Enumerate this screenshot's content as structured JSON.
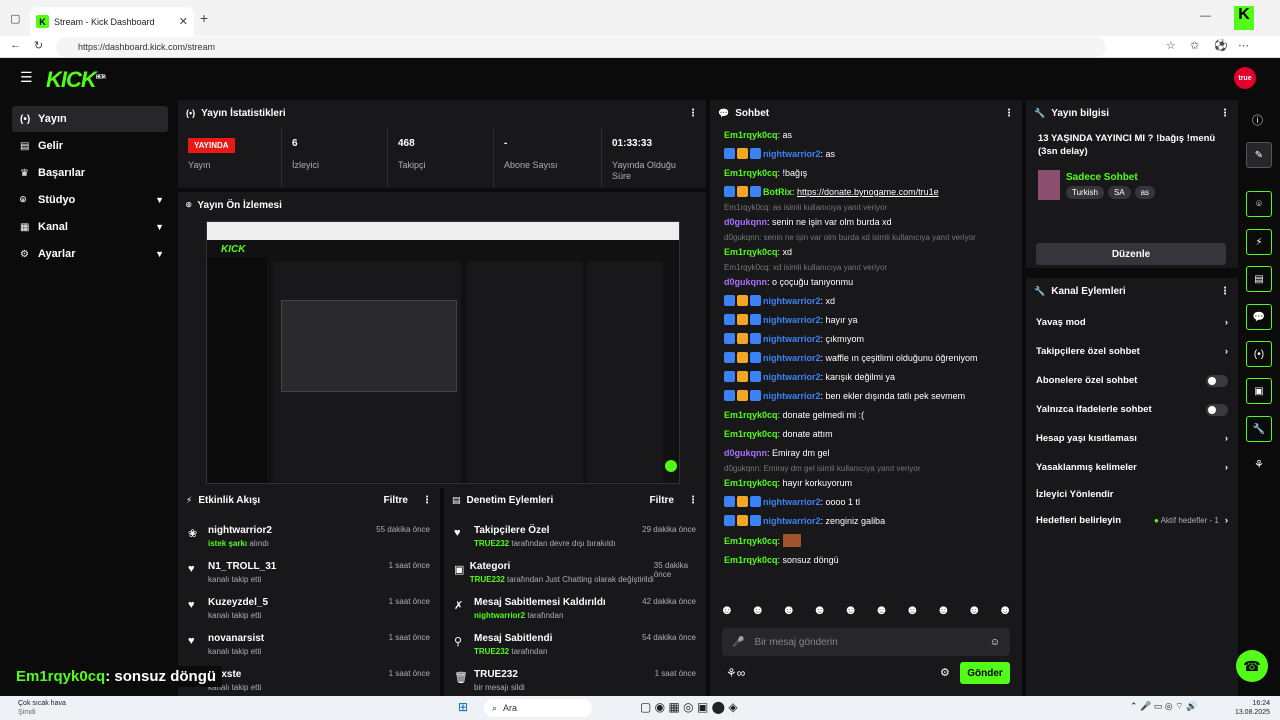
{
  "browser": {
    "tab_title": "Stream - Kick Dashboard",
    "url": "https://dashboard.kick.com/stream"
  },
  "app": {
    "logo": "KICK",
    "logo_badge": "BETA",
    "avatar_text": "true"
  },
  "sidebar": {
    "items": [
      {
        "label": "Yayın",
        "icon": "broadcast-icon"
      },
      {
        "label": "Gelir",
        "icon": "wallet-icon"
      },
      {
        "label": "Başarılar",
        "icon": "trophy-icon"
      },
      {
        "label": "Stüdyo",
        "icon": "studio-icon"
      },
      {
        "label": "Kanal",
        "icon": "channel-icon"
      },
      {
        "label": "Ayarlar",
        "icon": "gear-icon"
      }
    ]
  },
  "stats": {
    "title": "Yayın İstatistikleri",
    "live_badge": "YAYINDA",
    "items": [
      {
        "value": "",
        "label": "Yayın"
      },
      {
        "value": "6",
        "label": "İzleyici"
      },
      {
        "value": "468",
        "label": "Takipçi"
      },
      {
        "value": "-",
        "label": "Abone Sayısı"
      },
      {
        "value": "01:33:33",
        "label": "Yayında Olduğu Süre"
      }
    ]
  },
  "preview": {
    "title": "Yayın Ön İzlemesi"
  },
  "activity": {
    "title": "Etkinlik Akışı",
    "filter": "Filtre",
    "items": [
      {
        "user": "nightwarrior2",
        "sub_green": "istek şarkı",
        "sub": "alındı",
        "time": "55 dakika önce"
      },
      {
        "user": "N1_TROLL_31",
        "sub_green": "",
        "sub": "kanalı takip etti",
        "time": "1 saat önce"
      },
      {
        "user": "Kuzeyzdel_5",
        "sub_green": "",
        "sub": "kanalı takip etti",
        "time": "1 saat önce"
      },
      {
        "user": "novanarsist",
        "sub_green": "",
        "sub": "kanalı takip etti",
        "time": "1 saat önce"
      },
      {
        "user": "Doxste",
        "sub_green": "",
        "sub": "kanalı takip etti",
        "time": "1 saat önce"
      }
    ]
  },
  "moderation": {
    "title": "Denetim Eylemleri",
    "filter": "Filtre",
    "items": [
      {
        "title": "Takipçilere Özel",
        "green": "TRUE232",
        "rest": "tarafından devre dışı bırakıldı",
        "time": "29 dakika önce"
      },
      {
        "title": "Kategori",
        "green": "TRUE232",
        "rest": "tarafından Just Chatting olarak değiştirildi",
        "time": "35 dakika önce"
      },
      {
        "title": "Mesaj Sabitlemesi Kaldırıldı",
        "green": "nightwarrior2",
        "rest": "tarafından",
        "time": "42 dakika önce"
      },
      {
        "title": "Mesaj Sabitlendi",
        "green": "TRUE232",
        "rest": "tarafından",
        "time": "54 dakika önce"
      },
      {
        "title": "TRUE232",
        "green": "",
        "rest": "bir mesajı sildi",
        "time": "1 saat önce"
      }
    ]
  },
  "overlay_text": {
    "user": "Em1rqyk0cq",
    "msg": ": sonsuz döngü"
  },
  "chat": {
    "title": "Sohbet",
    "placeholder": "Bir mesaj gönderin",
    "send": "Gönder",
    "lines": [
      {
        "type": "msg",
        "user": "Em1rqyk0cq",
        "color": "#53fc18",
        "badges": false,
        "text": "as"
      },
      {
        "type": "msg",
        "user": "nightwarrior2",
        "color": "#3b82f6",
        "badges": true,
        "text": "as"
      },
      {
        "type": "msg",
        "user": "Em1rqyk0cq",
        "color": "#53fc18",
        "badges": false,
        "text": "!bağış"
      },
      {
        "type": "msg",
        "user": "BotRix",
        "color": "#53fc18",
        "badges": true,
        "text": "https://donate.bynogame.com/tru1e"
      },
      {
        "type": "reply",
        "text": "Em1rqyk0cq: as isimli kullanıcıya yanıt veriyor"
      },
      {
        "type": "msg",
        "user": "d0gukqnn",
        "color": "#a970ff",
        "badges": false,
        "text": "senin ne işin var olm burda xd"
      },
      {
        "type": "reply",
        "text": "d0gukqnn: senin ne işin var olm burda xd isimli kullanıcıya yanıt veriyor"
      },
      {
        "type": "msg",
        "user": "Em1rqyk0cq",
        "color": "#53fc18",
        "badges": false,
        "text": "xd"
      },
      {
        "type": "reply",
        "text": "Em1rqyk0cq: xd isimli kullanıcıya yanıt veriyor"
      },
      {
        "type": "msg",
        "user": "d0gukqnn",
        "color": "#a970ff",
        "badges": false,
        "text": "o çoçuğu tanıyonmu"
      },
      {
        "type": "msg",
        "user": "nightwarrior2",
        "color": "#3b82f6",
        "badges": true,
        "text": "xd"
      },
      {
        "type": "msg",
        "user": "nightwarrior2",
        "color": "#3b82f6",
        "badges": true,
        "text": "hayır ya"
      },
      {
        "type": "msg",
        "user": "nightwarrior2",
        "color": "#3b82f6",
        "badges": true,
        "text": "çıkmıyom"
      },
      {
        "type": "msg",
        "user": "nightwarrior2",
        "color": "#3b82f6",
        "badges": true,
        "text": "waffle ın çeşitlimi olduğunu öğreniyom"
      },
      {
        "type": "msg",
        "user": "nightwarrior2",
        "color": "#3b82f6",
        "badges": true,
        "text": "karışık değilmi ya"
      },
      {
        "type": "msg",
        "user": "nightwarrior2",
        "color": "#3b82f6",
        "badges": true,
        "text": "ben ekler dışında tatlı pek sevmem"
      },
      {
        "type": "msg",
        "user": "Em1rqyk0cq",
        "color": "#53fc18",
        "badges": false,
        "text": "donate gelmedi mi :("
      },
      {
        "type": "msg",
        "user": "Em1rqyk0cq",
        "color": "#53fc18",
        "badges": false,
        "text": "donate attım"
      },
      {
        "type": "msg",
        "user": "d0gukqnn",
        "color": "#a970ff",
        "badges": false,
        "text": "Emiray dm gel"
      },
      {
        "type": "reply",
        "text": "d0gukqnn: Emiray dm gel isimli kullanıcıya yanıt veriyor"
      },
      {
        "type": "msg",
        "user": "Em1rqyk0cq",
        "color": "#53fc18",
        "badges": false,
        "text": "hayır korkuyorum"
      },
      {
        "type": "msg",
        "user": "nightwarrior2",
        "color": "#3b82f6",
        "badges": true,
        "text": "oooo 1 tl"
      },
      {
        "type": "msg",
        "user": "nightwarrior2",
        "color": "#3b82f6",
        "badges": true,
        "text": "zenginiz galiba"
      },
      {
        "type": "msg",
        "user": "Em1rqyk0cq",
        "color": "#53fc18",
        "badges": false,
        "text": ""
      },
      {
        "type": "msg",
        "user": "Em1rqyk0cq",
        "color": "#53fc18",
        "badges": false,
        "text": "sonsuz döngü"
      }
    ]
  },
  "info": {
    "title": "Yayın bilgisi",
    "stream_title": "13 YAŞINDA YAYINCI MI ? !bağış !menü (3sn delay)",
    "category": "Sadece Sohbet",
    "tags": [
      "Turkish",
      "SA",
      "as"
    ],
    "edit": "Düzenle"
  },
  "channel": {
    "title": "Kanal Eylemleri",
    "items": [
      {
        "label": "Yavaş mod",
        "ctl": "chevron"
      },
      {
        "label": "Takipçilere özel sohbet",
        "ctl": "chevron"
      },
      {
        "label": "Abonelere özel sohbet",
        "ctl": "toggle"
      },
      {
        "label": "Yalnızca ifadelerle sohbet",
        "ctl": "toggle"
      },
      {
        "label": "Hesap yaşı kısıtlaması",
        "ctl": "chevron"
      },
      {
        "label": "Yasaklanmış kelimeler",
        "ctl": "chevron"
      },
      {
        "label": "İzleyici Yönlendir",
        "ctl": "none"
      },
      {
        "label": "Hedefleri belirleyin",
        "ctl": "chevron"
      }
    ],
    "goal_status": "Aktif hedefler - 1"
  },
  "taskbar": {
    "weather": "Çok sıcak hava",
    "weather_sub": "Şimdi",
    "search": "Ara",
    "time": "16:24",
    "date": "13.08.2025"
  },
  "colors": {
    "accent": "#53fc18",
    "panel": "#18181b",
    "live": "#e91916"
  }
}
